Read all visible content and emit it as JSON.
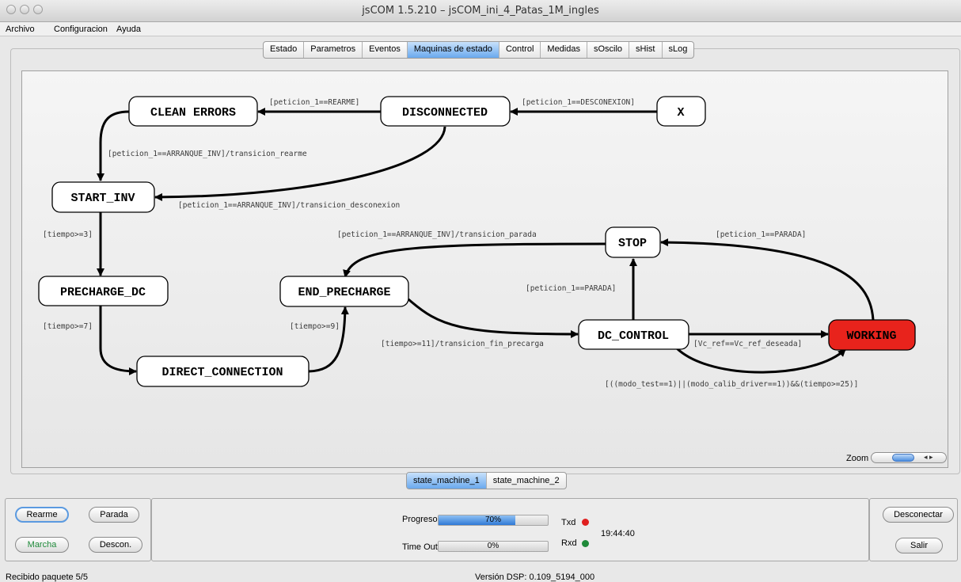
{
  "window": {
    "title": "jsCOM 1.5.210 – jsCOM_ini_4_Patas_1M_ingles"
  },
  "menu": [
    "Archivo",
    "Configuracion",
    "Ayuda"
  ],
  "tabs": [
    "Estado",
    "Parametros",
    "Eventos",
    "Maquinas de estado",
    "Control",
    "Medidas",
    "sOscilo",
    "sHist",
    "sLog"
  ],
  "active_tab": "Maquinas de estado",
  "state_machine": {
    "states": {
      "clean_errors": "CLEAN ERRORS",
      "disconnected": "DISCONNECTED",
      "x": "X",
      "start_inv": "START_INV",
      "stop": "STOP",
      "precharge_dc": "PRECHARGE_DC",
      "end_precharge": "END_PRECHARGE",
      "dc_control": "DC_CONTROL",
      "working": "WORKING",
      "direct_connection": "DIRECT_CONNECTION"
    },
    "active_state": "WORKING",
    "active_color": "#e8231c",
    "transitions": {
      "x_to_disconnected": "[peticion_1==DESCONEXION]",
      "disconnected_to_clean": "[peticion_1==REARME]",
      "clean_to_start": "[peticion_1==ARRANQUE_INV]/transicion_rearme",
      "disconnected_to_start": "[peticion_1==ARRANQUE_INV]/transicion_desconexion",
      "start_to_precharge": "[tiempo>=3]",
      "stop_to_end": "[peticion_1==ARRANQUE_INV]/transicion_parada",
      "working_to_stop": "[peticion_1==PARADA]",
      "dc_to_stop": "[peticion_1==PARADA]",
      "precharge_to_direct": "[tiempo>=7]",
      "direct_to_end": "[tiempo>=9]",
      "end_to_dc": "[tiempo>=11]/transicion_fin_precarga",
      "dc_to_working": "[Vc_ref==Vc_ref_deseada]",
      "dc_to_working_test": "[((modo_test==1)||(modo_calib_driver==1))&&(tiempo>=25)]"
    }
  },
  "zoom": {
    "label": "Zoom"
  },
  "sm_tabs": [
    "state_machine_1",
    "state_machine_2"
  ],
  "active_sm_tab": "state_machine_1",
  "controls": {
    "rearme": "Rearme",
    "parada": "Parada",
    "marcha": "Marcha",
    "descon": "Descon.",
    "desconectar": "Desconectar",
    "salir": "Salir"
  },
  "status": {
    "progreso_label": "Progreso",
    "progreso_value": 70,
    "progreso_text": "70%",
    "timeout_label": "Time Out",
    "timeout_value": 0,
    "timeout_text": "0%",
    "txd_label": "Txd",
    "rxd_label": "Rxd",
    "txd_color": "#e02020",
    "rxd_color": "#1f8a3a",
    "time": "19:44:40"
  },
  "footer": {
    "left": "Recibido paquete 5/5",
    "center": "Versión DSP: 0.109_5194_000"
  }
}
